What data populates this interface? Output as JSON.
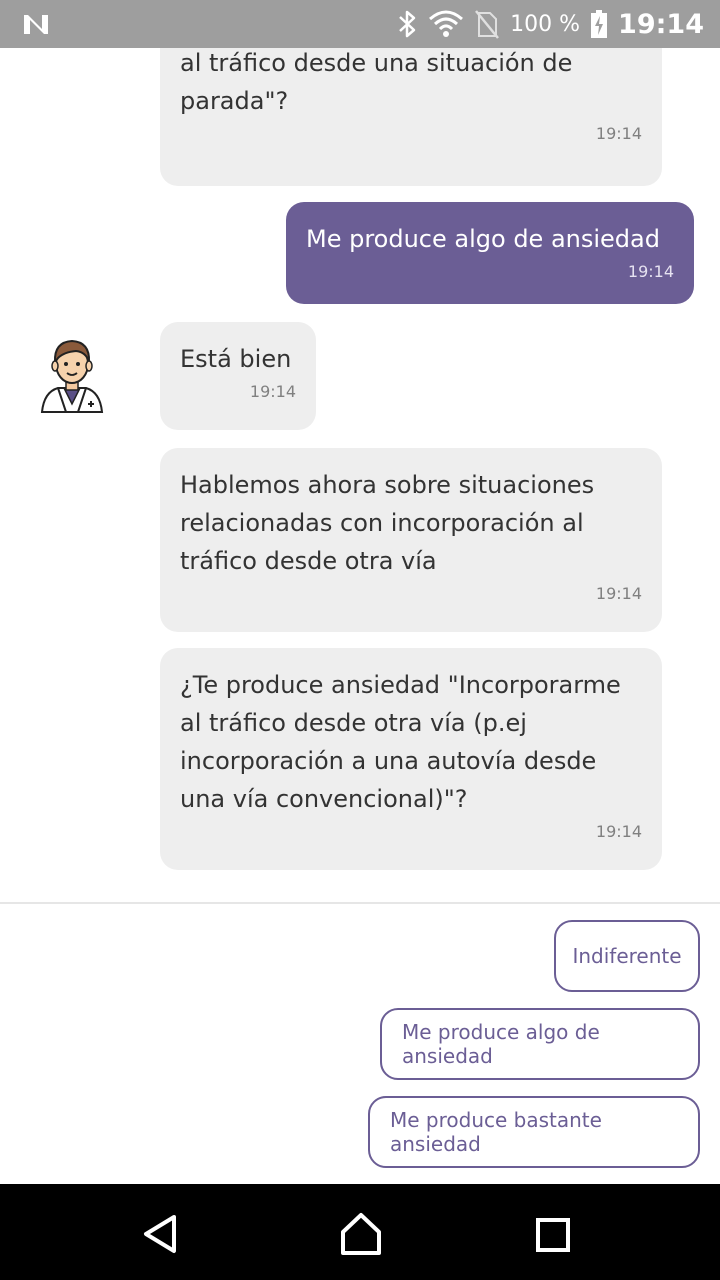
{
  "status_bar": {
    "battery_percent": "100 %",
    "time": "19:14",
    "icons": [
      "n-logo-icon",
      "bluetooth-icon",
      "wifi-icon",
      "no-sim-icon",
      "battery-charging-icon"
    ]
  },
  "chat": {
    "messages": [
      {
        "sender": "bot",
        "text": "¿Te produce ansiedad \"Incorporarme al tráfico desde una situación de parada\"?",
        "time": "19:14"
      },
      {
        "sender": "user",
        "text": "Me produce algo de ansiedad",
        "time": "19:14"
      },
      {
        "sender": "bot",
        "text": "Está bien",
        "time": "19:14"
      },
      {
        "sender": "bot",
        "text": "Hablemos ahora sobre situaciones relacionadas con incorporación al tráfico desde otra vía",
        "time": "19:14"
      },
      {
        "sender": "bot",
        "text": "¿Te produce ansiedad \"Incorporarme al tráfico desde otra vía (p.ej incorporación a una autovía desde una vía convencional)\"?",
        "time": "19:14"
      }
    ],
    "avatar_icon": "doctor-avatar-icon"
  },
  "options": [
    {
      "label": "Indiferente"
    },
    {
      "label": "Me produce algo de ansiedad"
    },
    {
      "label": "Me produce bastante ansiedad"
    }
  ],
  "nav_bar": {
    "icons": [
      "back-icon",
      "home-icon",
      "recents-icon"
    ]
  },
  "colors": {
    "accent": "#6b5e95",
    "bot_bubble": "#eeeeee",
    "status_bar": "#9e9e9e"
  }
}
